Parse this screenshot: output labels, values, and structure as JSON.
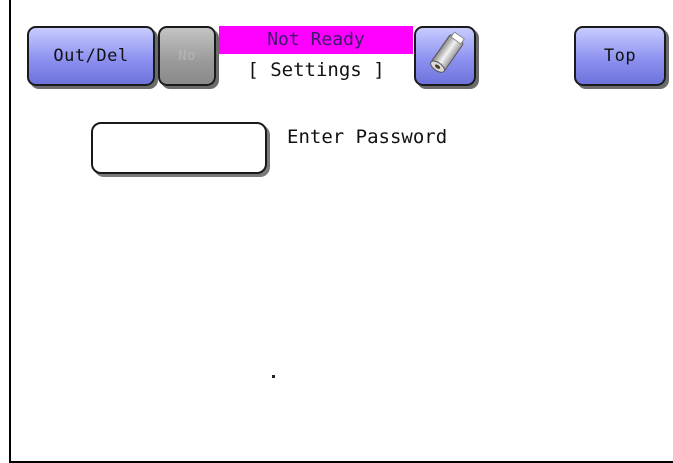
{
  "header": {
    "out_del_label": "Out/Del",
    "disabled_button_label": "No",
    "status_text": "Not Ready",
    "mode_text": "[ Settings ]",
    "paper_icon": "paper-roll-icon",
    "top_label": "Top"
  },
  "main": {
    "password_field_value": "",
    "password_label": "Enter Password"
  },
  "colors": {
    "button_blue": "#8d92f0",
    "status_magenta": "#ff00ff",
    "disabled_gray": "#9a9a9a"
  }
}
